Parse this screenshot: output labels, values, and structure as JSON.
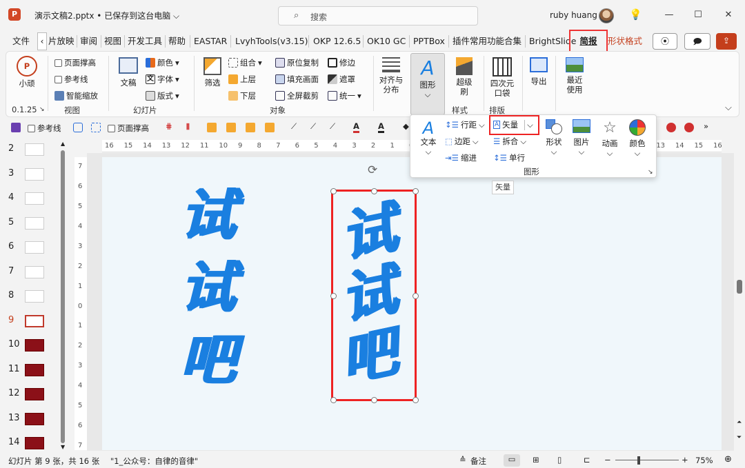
{
  "window": {
    "doc_title": "演示文稿2.pptx • 已保存到这台电脑 ⌵",
    "search_icon": "⌕",
    "search_placeholder": "搜索",
    "user_name": "ruby huang",
    "minimize": "—",
    "maximize": "☐",
    "close": "✕"
  },
  "tabs": [
    "文件",
    "‹",
    "片放映",
    "审阅",
    "视图",
    "开发工具",
    "帮助",
    "EASTAR",
    "LvyhTools(v3.15)",
    "OKP 12.6.5",
    "OK10 GC",
    "PPTBox",
    "插件常用功能合集",
    "BrightSlide",
    "简报",
    "形状格式"
  ],
  "ribbon": {
    "xiaoding": {
      "label": "小顽",
      "version": "0.1.25"
    },
    "view": {
      "items": [
        "页面撑高",
        "参考线",
        "智能缩放"
      ],
      "group": "视图"
    },
    "slide": {
      "big": "文稿",
      "items": [
        "颜色",
        "字体",
        "版式"
      ],
      "group": "幻灯片"
    },
    "object": {
      "big": "筛选",
      "items": [
        "组合",
        "上层",
        "下层",
        "原位复制",
        "填充画面",
        "全屏截剪",
        "修边",
        "遮罩",
        "统一"
      ],
      "group": "对象"
    },
    "align": {
      "big": "对齐与分布"
    },
    "shape": {
      "big": "图形"
    },
    "style": {
      "big": "超级刷",
      "group": "样式"
    },
    "layout": {
      "big": "四次元口袋",
      "group": "排版"
    },
    "export": {
      "big": "导出"
    },
    "recent": {
      "big": "最近使用"
    }
  },
  "qat": {
    "items": [
      "参考线",
      "页面撑高"
    ]
  },
  "panel": {
    "text": "文本",
    "line_spacing": "行距",
    "margin": "边距",
    "indent": "缩进",
    "vector": "矢量",
    "split": "拆合",
    "single_line": "单行",
    "shape": "形状",
    "picture": "图片",
    "animation": "动画",
    "color": "颜色",
    "group": "图形"
  },
  "tooltip": "矢量",
  "thumbnails": [
    "2",
    "3",
    "4",
    "5",
    "6",
    "7",
    "8",
    "9",
    "10",
    "11",
    "12",
    "13",
    "14"
  ],
  "ruler_h": [
    "16",
    "15",
    "14",
    "13",
    "12",
    "11",
    "10",
    "9",
    "8",
    "7",
    "6",
    "5",
    "4",
    "3",
    "2",
    "1",
    "0",
    "1",
    "2",
    "3",
    "4",
    "5",
    "6",
    "7",
    "8",
    "9",
    "10",
    "11",
    "12",
    "13",
    "14",
    "15",
    "16"
  ],
  "ruler_v": [
    "7",
    "6",
    "5",
    "4",
    "3",
    "2",
    "1",
    "0",
    "1",
    "2",
    "3",
    "4",
    "5",
    "6",
    "7"
  ],
  "slide_text": {
    "left": [
      "试",
      "试",
      "吧"
    ],
    "right": [
      "试",
      "试",
      "吧"
    ]
  },
  "status": {
    "slide_info": "幻灯片 第 9 张，共 16 张",
    "layout": "\"1_公众号：自律的音律\"",
    "notes": "备注",
    "zoom": "75%"
  },
  "colors": {
    "accent": "#c43e1c",
    "calligraphy": "#1a7fe0",
    "highlight": "#e22222"
  }
}
